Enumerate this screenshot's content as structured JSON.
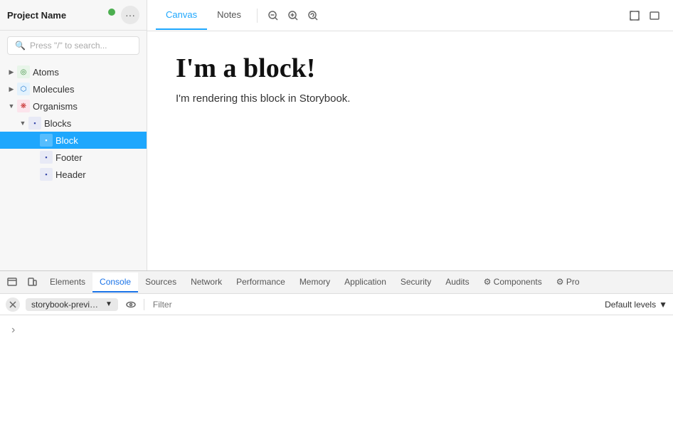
{
  "sidebar": {
    "project_name": "Project Name",
    "search_placeholder": "Press \"/\" to search...",
    "items": [
      {
        "id": "atoms",
        "label": "Atoms",
        "level": 0,
        "icon": "atom",
        "arrow": "▶"
      },
      {
        "id": "molecules",
        "label": "Molecules",
        "level": 0,
        "icon": "molecule",
        "arrow": "▶"
      },
      {
        "id": "organisms",
        "label": "Organisms",
        "level": 0,
        "icon": "organism",
        "arrow": "▼"
      },
      {
        "id": "blocks",
        "label": "Blocks",
        "level": 1,
        "icon": "blocks",
        "arrow": "▼"
      },
      {
        "id": "block",
        "label": "Block",
        "level": 2,
        "icon": "block",
        "arrow": "",
        "selected": true
      },
      {
        "id": "footer",
        "label": "Footer",
        "level": 2,
        "icon": "footer",
        "arrow": ""
      },
      {
        "id": "header",
        "label": "Header",
        "level": 2,
        "icon": "header",
        "arrow": ""
      }
    ]
  },
  "canvas": {
    "tabs": [
      {
        "id": "canvas",
        "label": "Canvas",
        "active": true
      },
      {
        "id": "notes",
        "label": "Notes",
        "active": false
      }
    ],
    "title": "I'm a block!",
    "subtitle": "I'm rendering this block in Storybook."
  },
  "devtools": {
    "tabs": [
      {
        "id": "elements",
        "label": "Elements"
      },
      {
        "id": "console",
        "label": "Console",
        "active": true
      },
      {
        "id": "sources",
        "label": "Sources"
      },
      {
        "id": "network",
        "label": "Network"
      },
      {
        "id": "performance",
        "label": "Performance"
      },
      {
        "id": "memory",
        "label": "Memory"
      },
      {
        "id": "application",
        "label": "Application"
      },
      {
        "id": "security",
        "label": "Security"
      },
      {
        "id": "audits",
        "label": "Audits"
      },
      {
        "id": "components",
        "label": "⚙ Components"
      },
      {
        "id": "profiler",
        "label": "⚙ Pro"
      }
    ],
    "context_selector": "storybook-preview...",
    "filter_placeholder": "Filter",
    "levels_label": "Default levels",
    "expand_arrow": "›"
  }
}
